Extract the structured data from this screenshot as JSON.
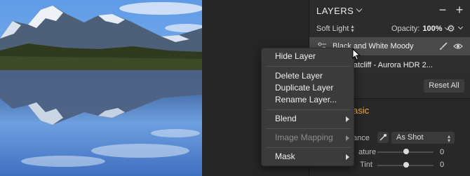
{
  "panel": {
    "title": "LAYERS",
    "blend_mode": "Soft Light",
    "opacity_label": "Opacity:",
    "opacity_value": "100%"
  },
  "layers": [
    {
      "name": "Black and White Moody",
      "selected": true
    },
    {
      "name": "atcliff - Aurora HDR 2...",
      "selected": false
    }
  ],
  "reset_button": "Reset All",
  "filter": {
    "title": "asic",
    "white_balance_label": "ance",
    "white_balance_value": "As Shot",
    "sliders": [
      {
        "label": "ature",
        "value": "0"
      },
      {
        "label": "Tint",
        "value": "0"
      }
    ]
  },
  "context_menu": {
    "items": [
      {
        "label": "Hide Layer",
        "enabled": true,
        "submenu": false
      },
      {
        "label": "Delete Layer",
        "enabled": true,
        "submenu": false
      },
      {
        "label": "Duplicate Layer",
        "enabled": true,
        "submenu": false
      },
      {
        "label": "Rename Layer...",
        "enabled": true,
        "submenu": false
      },
      {
        "label": "Blend",
        "enabled": true,
        "submenu": true
      },
      {
        "label": "Image Mapping",
        "enabled": false,
        "submenu": true
      },
      {
        "label": "Mask",
        "enabled": true,
        "submenu": true
      }
    ]
  },
  "colors": {
    "accent_orange": "#f2b33d",
    "panel_bg": "#2c2c2c",
    "menu_bg": "#3b3b3b",
    "selected_row": "#4a4a4a"
  },
  "icons": [
    "minus-icon",
    "plus-icon",
    "gear-icon",
    "sliders-icon",
    "brush-icon",
    "eye-icon",
    "eyedropper-icon",
    "chevron-down-icon",
    "submenu-arrow-icon",
    "mouse-cursor-icon"
  ]
}
